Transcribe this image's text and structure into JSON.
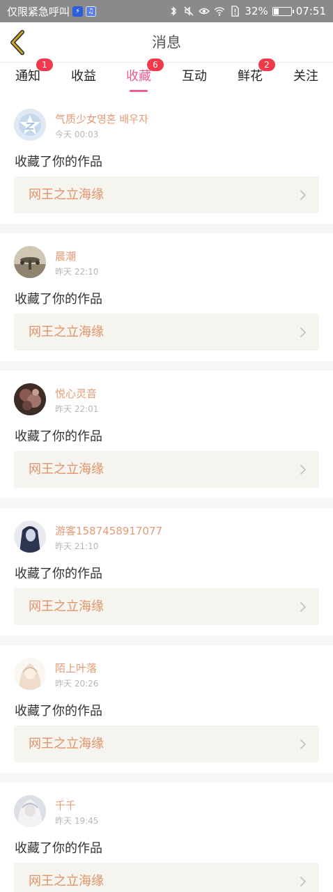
{
  "status_bar": {
    "carrier_text": "仅限紧急呼叫",
    "battery_text": "32%",
    "battery_level": 0.32,
    "time": "07:51"
  },
  "header": {
    "title": "消息"
  },
  "tabs": [
    {
      "label": "通知",
      "badge": "1"
    },
    {
      "label": "收益",
      "badge": ""
    },
    {
      "label": "收藏",
      "badge": "6"
    },
    {
      "label": "互动",
      "badge": ""
    },
    {
      "label": "鲜花",
      "badge": "2"
    },
    {
      "label": "关注",
      "badge": ""
    }
  ],
  "active_tab": "收藏",
  "feed": [
    {
      "username": "气质少女영혼 배우자",
      "time": "今天 00:03",
      "action": "收藏了你的作品",
      "work": "网王之立海缘"
    },
    {
      "username": "晨潮",
      "time": "昨天 22:10",
      "action": "收藏了你的作品",
      "work": "网王之立海缘"
    },
    {
      "username": "悦心灵音",
      "time": "昨天 22:01",
      "action": "收藏了你的作品",
      "work": "网王之立海缘"
    },
    {
      "username": "游客1587458917077",
      "time": "昨天 21:10",
      "action": "收藏了你的作品",
      "work": "网王之立海缘"
    },
    {
      "username": "陌上叶落",
      "time": "昨天 20:26",
      "action": "收藏了你的作品",
      "work": "网王之立海缘"
    },
    {
      "username": "千千",
      "time": "昨天 19:45",
      "action": "收藏了你的作品",
      "work": "网王之立海缘"
    }
  ],
  "colors": {
    "accent": "#e85d93",
    "username": "#e59a73",
    "work_title": "#e0936a",
    "badge": "#f0394b",
    "back_arrow": "#c9a52a"
  }
}
